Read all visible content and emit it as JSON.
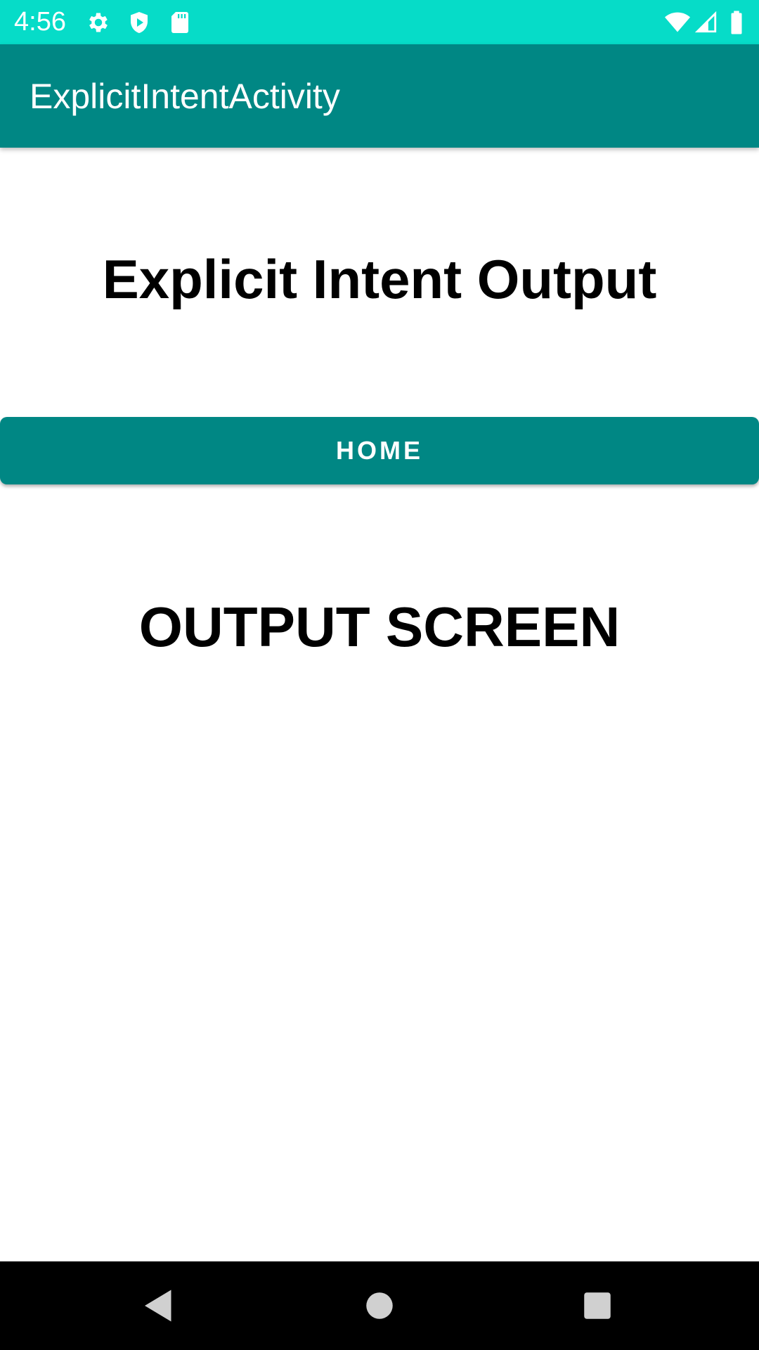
{
  "status_bar": {
    "time": "4:56",
    "background_color": "#06dcc8",
    "left_icons": [
      "gear-icon",
      "shield-play-icon",
      "sd-card-icon"
    ],
    "right_icons": [
      "wifi-icon",
      "signal-icon",
      "battery-icon"
    ]
  },
  "app_bar": {
    "title": "ExplicitIntentActivity",
    "background_color": "#008784"
  },
  "main": {
    "heading": "Explicit Intent Output",
    "home_button_label": "HOME",
    "screen_label": "OUTPUT SCREEN"
  },
  "nav_bar": {
    "buttons": [
      "back-icon",
      "home-icon",
      "recents-icon"
    ]
  }
}
